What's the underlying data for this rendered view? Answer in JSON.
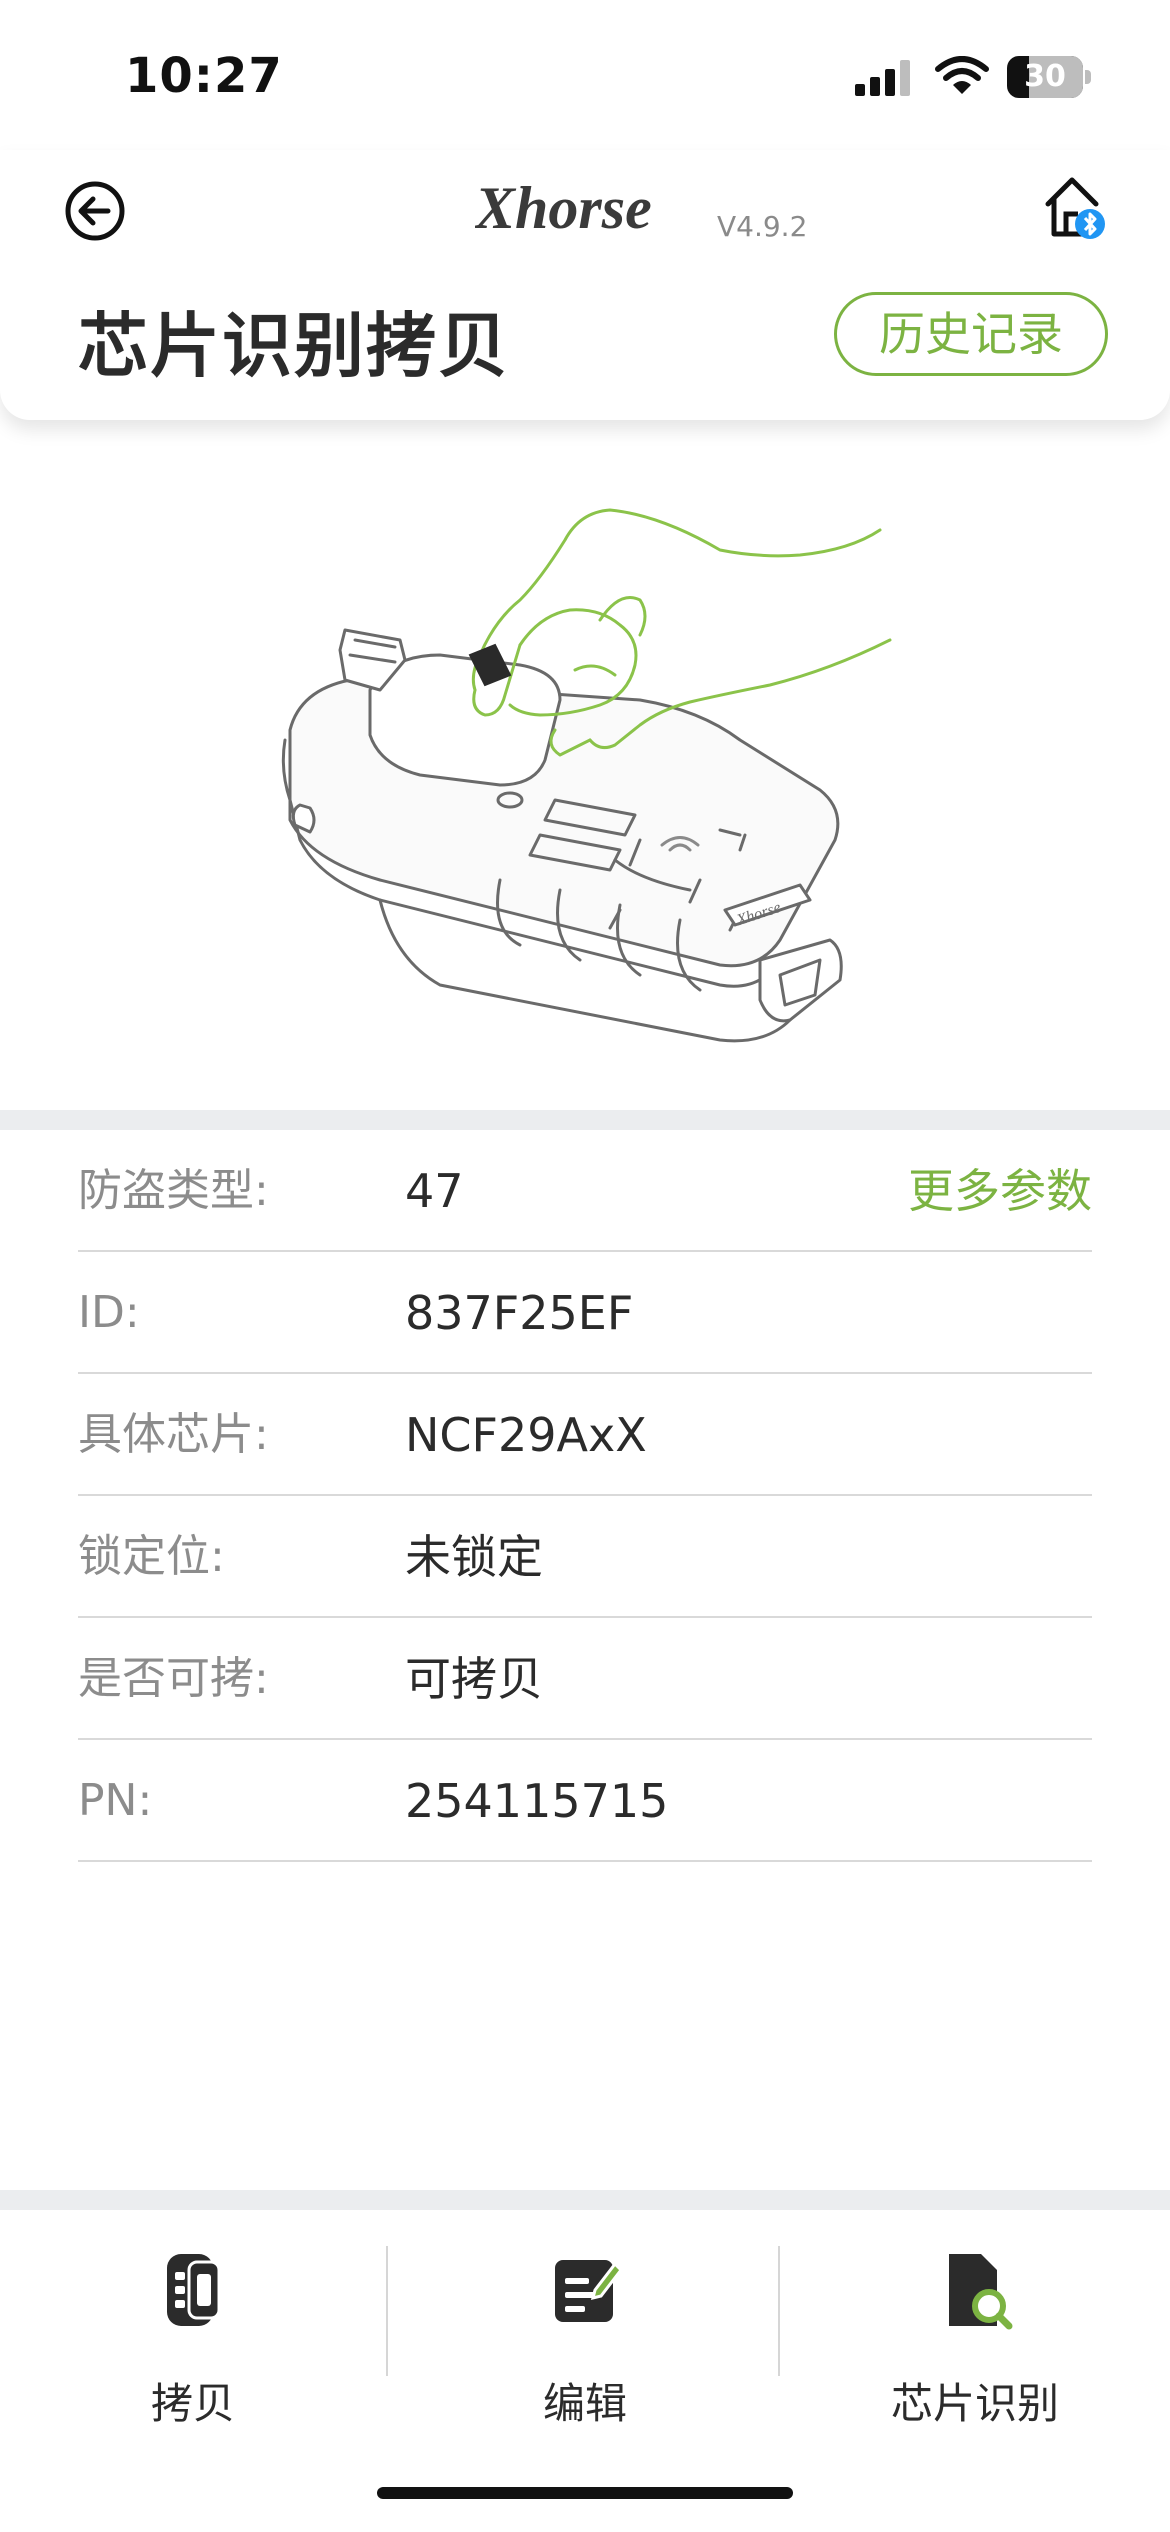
{
  "status_bar": {
    "time": "10:27",
    "battery_level": "30"
  },
  "header": {
    "logo_text": "Xhorse",
    "version": "V4.9.2",
    "title": "芯片识别拷贝",
    "history_label": "历史记录",
    "icons": {
      "back": "back-arrow-icon",
      "home": "home-bluetooth-icon"
    }
  },
  "colors": {
    "accent": "#7cb342",
    "divider": "#ebedef",
    "text": "#2b2b2b",
    "label": "#8c8c8c"
  },
  "info": {
    "more_params_label": "更多参数",
    "rows": [
      {
        "label": "防盗类型:",
        "value": "47"
      },
      {
        "label": "ID:",
        "value": "837F25EF"
      },
      {
        "label": "具体芯片:",
        "value": "NCF29AxX"
      },
      {
        "label": "锁定位:",
        "value": "未锁定"
      },
      {
        "label": "是否可拷:",
        "value": "可拷贝"
      },
      {
        "label": "PN:",
        "value": "254115715"
      }
    ]
  },
  "tabs": [
    {
      "label": "拷贝",
      "icon": "car-key-icon"
    },
    {
      "label": "编辑",
      "icon": "edit-document-icon"
    },
    {
      "label": "芯片识别",
      "icon": "chip-search-icon"
    }
  ]
}
